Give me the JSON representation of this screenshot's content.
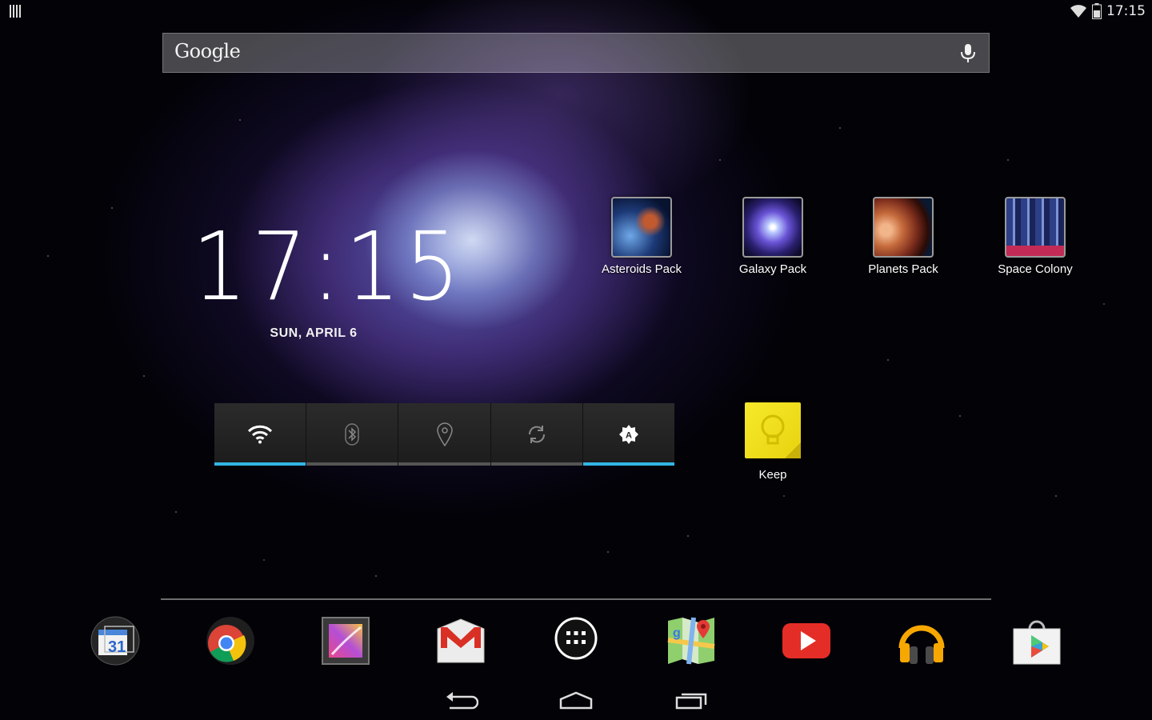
{
  "status_bar": {
    "time": "17:15"
  },
  "search": {
    "logo": "Google"
  },
  "clock": {
    "time": "17:15",
    "date": "SUN, APRIL 6"
  },
  "power_widget": {
    "toggles": [
      {
        "name": "wifi",
        "on": true
      },
      {
        "name": "bluetooth",
        "on": false
      },
      {
        "name": "location",
        "on": false
      },
      {
        "name": "sync",
        "on": false
      },
      {
        "name": "brightness-auto",
        "on": true
      }
    ]
  },
  "apps": {
    "asteroids": "Asteroids Pack",
    "galaxy": "Galaxy Pack",
    "planets": "Planets Pack",
    "space_colony": "Space Colony",
    "keep": "Keep"
  },
  "dock": {
    "calendar_day": "31"
  },
  "colors": {
    "accent": "#33b5e5",
    "keep_yellow": "#f2e21a"
  }
}
